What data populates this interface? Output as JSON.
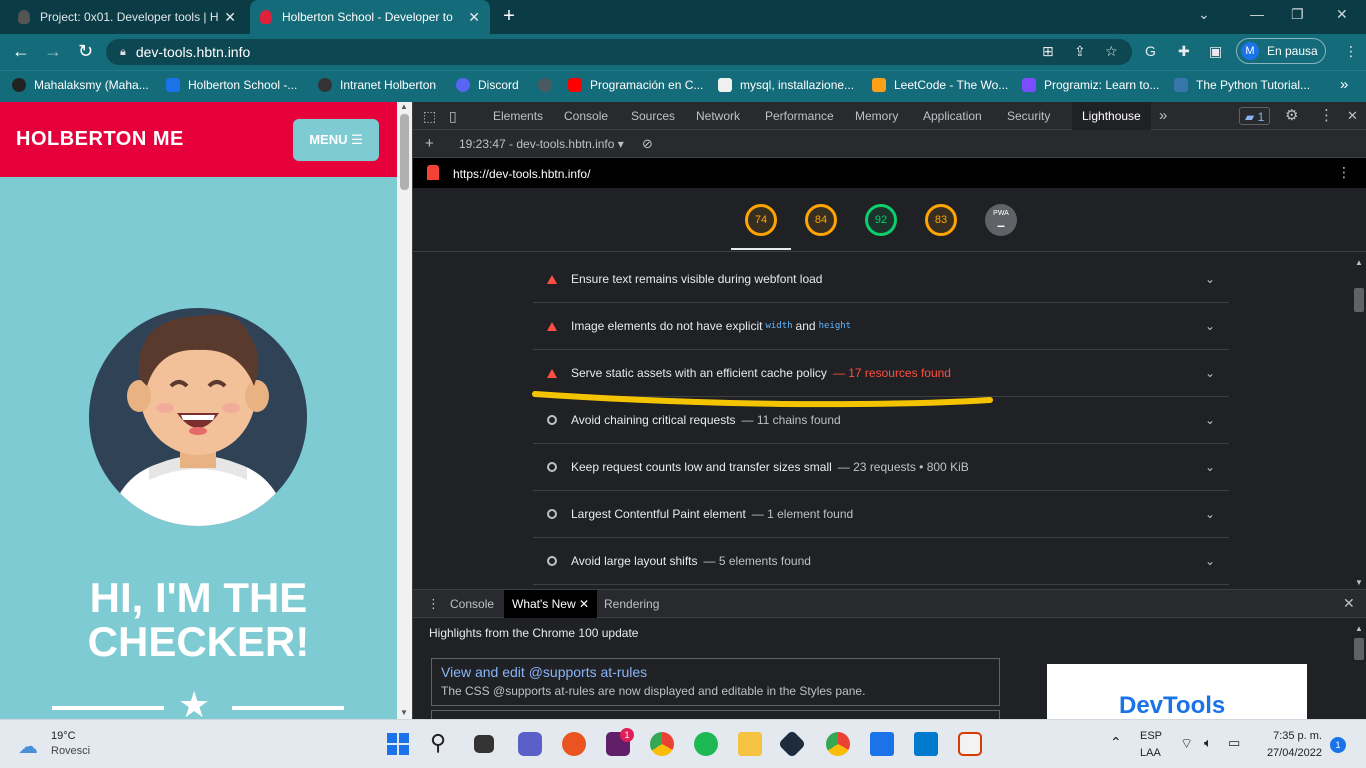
{
  "browser": {
    "tabs": [
      {
        "title": "Project: 0x01. Developer tools | H",
        "active": false
      },
      {
        "title": "Holberton School - Developer to",
        "active": true
      }
    ],
    "new_tab": "+",
    "url": "dev-tools.hbtn.info",
    "profile_initial": "M",
    "profile_status": "En pausa",
    "bookmarks": [
      "Mahalaksmy (Maha...",
      "Holberton School -...",
      "Intranet Holberton",
      "Discord",
      "Programación en C...",
      "mysql, installazione...",
      "LeetCode - The Wo...",
      "Programiz: Learn to...",
      "The Python Tutorial..."
    ],
    "bookmarks_more": "»"
  },
  "page": {
    "brand": "HOLBERTON ME",
    "menu_label": "MENU ☰",
    "headline_line1": "HI, I'M THE",
    "headline_line2": "CHECKER!"
  },
  "devtools": {
    "tabs": [
      "Elements",
      "Console",
      "Sources",
      "Network",
      "Performance",
      "Memory",
      "Application",
      "Security",
      "Lighthouse"
    ],
    "active_tab": "Lighthouse",
    "more_tabs": "»",
    "issues_count": "1",
    "report_time": "19:23:47 - dev-tools.hbtn.info ▾",
    "report_url": "https://dev-tools.hbtn.info/",
    "scores": [
      {
        "value": "74",
        "color": "#ffa400"
      },
      {
        "value": "84",
        "color": "#ffa400"
      },
      {
        "value": "92",
        "color": "#0cce6b"
      },
      {
        "value": "83",
        "color": "#ffa400"
      }
    ],
    "pwa_label": "PWA",
    "audits": [
      {
        "status": "fail",
        "title": "Ensure text remains visible during webfont load",
        "display": ""
      },
      {
        "status": "fail",
        "title": "Image elements do not have explicit",
        "code1": "width",
        "and": "and",
        "code2": "height",
        "display": ""
      },
      {
        "status": "fail",
        "title": "Serve static assets with an efficient cache policy",
        "display": "— 17 resources found"
      },
      {
        "status": "info",
        "title": "Avoid chaining critical requests",
        "display": "— 11 chains found"
      },
      {
        "status": "info",
        "title": "Keep request counts low and transfer sizes small",
        "display": "— 23 requests • 800 KiB"
      },
      {
        "status": "info",
        "title": "Largest Contentful Paint element",
        "display": "— 1 element found"
      },
      {
        "status": "info",
        "title": "Avoid large layout shifts",
        "display": "— 5 elements found"
      }
    ],
    "drawer": {
      "tabs": [
        "Console",
        "What's New",
        "Rendering"
      ],
      "active_tab": "What's New",
      "highlights": "Highlights from the Chrome 100 update",
      "news_title": "View and edit @supports at-rules",
      "news_desc": "The CSS @supports at-rules are now displayed and editable in the Styles pane.",
      "news_image_label": "DevTools"
    }
  },
  "taskbar": {
    "weather_temp": "19°C",
    "weather_desc": "Rovesci",
    "lang": "ESP",
    "layout": "LAA",
    "time": "7:35 p. m.",
    "date": "27/04/2022",
    "notif_count": "1",
    "slack_badge": "1"
  },
  "colors": {
    "chrome_frame": "#0b3b45",
    "chrome_toolbar": "#146b7a",
    "holberton_red": "#e5003b",
    "page_teal": "#7ecbd3",
    "lh_fail": "#ff4e42",
    "lh_average": "#ffa400",
    "lh_pass": "#0cce6b",
    "highlight_marker": "#f5c400"
  }
}
